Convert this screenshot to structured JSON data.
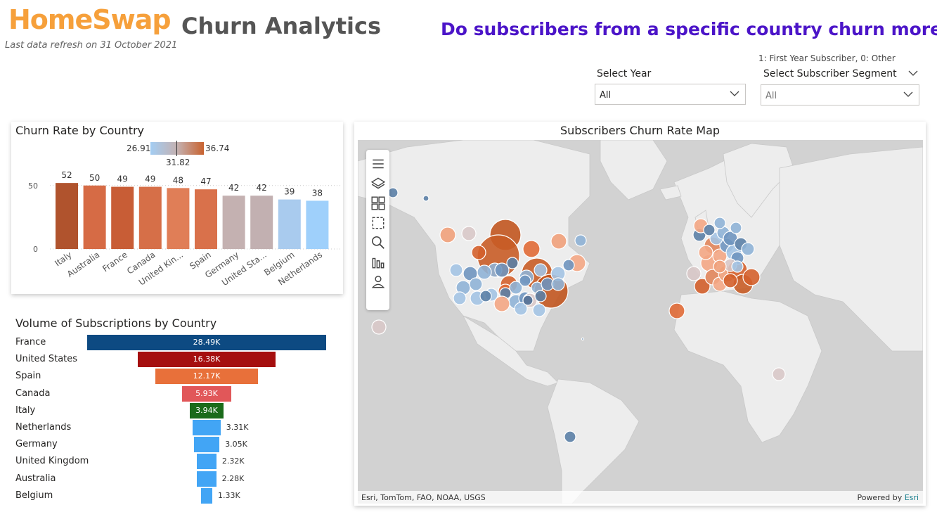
{
  "header": {
    "logo_text": "HomeSwap",
    "refresh_text": "Last data refresh on 31 October 2021",
    "title": "Churn Analytics",
    "question": "Do subscribers from a specific country churn more?"
  },
  "slicers": {
    "year_label": "Select Year",
    "year_value": "All",
    "segment_hint": "1: First Year Subscriber, 0: Other",
    "segment_label": "Select Subscriber Segment",
    "segment_value": "All"
  },
  "churn_chart": {
    "title": "Churn Rate by Country",
    "legend_min": "26.91",
    "legend_mid": "31.82",
    "legend_max": "36.74",
    "colors": {
      "low": "#a3cdf3",
      "mid": "#c4b1b1",
      "high": "#b0532d"
    }
  },
  "chart_data": [
    {
      "type": "bar",
      "title": "Churn Rate by Country",
      "categories": [
        "Italy",
        "Australia",
        "France",
        "Canada",
        "United Kin...",
        "Spain",
        "Germany",
        "United Sta...",
        "Belgium",
        "Netherlands"
      ],
      "values": [
        52,
        50,
        49,
        49,
        48,
        47,
        42,
        42,
        39,
        38
      ],
      "colors": [
        "#b0532d",
        "#d66b45",
        "#c85d36",
        "#d66f48",
        "#e07e57",
        "#d9714b",
        "#c4b1b1",
        "#c2b0b1",
        "#a9cbee",
        "#9fd0fb"
      ],
      "yticks": [
        0,
        50
      ],
      "ylim": [
        0,
        60
      ]
    },
    {
      "type": "bar",
      "title": "Volume of Subscriptions by Country",
      "categories": [
        "France",
        "United States",
        "Spain",
        "Canada",
        "Italy",
        "Netherlands",
        "Germany",
        "United Kingdom",
        "Australia",
        "Belgium"
      ],
      "values": [
        28490,
        16380,
        12170,
        5930,
        3940,
        3310,
        3050,
        2320,
        2280,
        1330
      ],
      "labels": [
        "28.49K",
        "16.38K",
        "12.17K",
        "5.93K",
        "3.94K",
        "3.31K",
        "3.05K",
        "2.32K",
        "2.28K",
        "1.33K"
      ],
      "colors": [
        "#0d4a82",
        "#a50f0f",
        "#e8703a",
        "#e15759",
        "#1a6b1a",
        "#42a5f5",
        "#42a5f5",
        "#42a5f5",
        "#42a5f5",
        "#42a5f5"
      ]
    }
  ],
  "volume_chart": {
    "title": "Volume of Subscriptions by Country"
  },
  "map": {
    "title": "Subscribers Churn Rate Map",
    "attribution": "Esri, TomTom, FAO, NOAA, USGS",
    "powered_prefix": "Powered by ",
    "powered_brand": "Esri",
    "tools": [
      "menu-icon",
      "layers-icon",
      "grid-icon",
      "select-rect-icon",
      "search-icon",
      "bars-icon",
      "person-icon"
    ]
  }
}
